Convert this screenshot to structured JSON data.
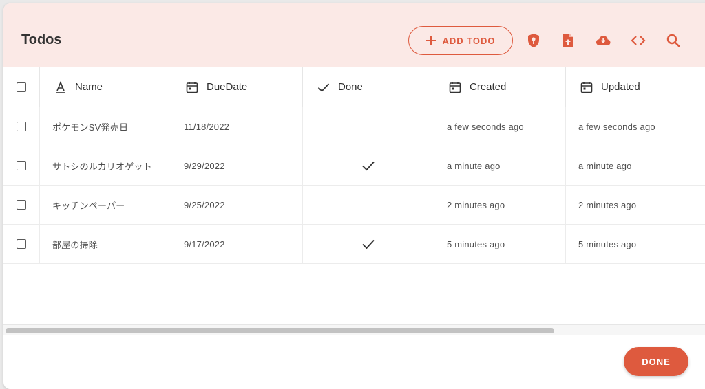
{
  "header": {
    "title": "Todos",
    "add_label": "ADD TODO"
  },
  "colors": {
    "accent": "#de5a3e",
    "header_bg": "#fbe9e6"
  },
  "icons": {
    "toolbar": [
      "shield-key-icon",
      "file-upload-icon",
      "cloud-download-icon",
      "code-icon",
      "search-icon"
    ]
  },
  "columns": [
    "Name",
    "DueDate",
    "Done",
    "Created",
    "Updated"
  ],
  "rows": [
    {
      "name": "ポケモンSV発売日",
      "due": "11/18/2022",
      "done": false,
      "created": "a few seconds ago",
      "updated": "a few seconds ago"
    },
    {
      "name": "サトシのルカリオゲット",
      "due": "9/29/2022",
      "done": true,
      "created": "a minute ago",
      "updated": "a minute ago"
    },
    {
      "name": "キッチンペーパー",
      "due": "9/25/2022",
      "done": false,
      "created": "2 minutes ago",
      "updated": "2 minutes ago"
    },
    {
      "name": "部屋の掃除",
      "due": "9/17/2022",
      "done": true,
      "created": "5 minutes ago",
      "updated": "5 minutes ago"
    }
  ],
  "footer": {
    "done_label": "DONE"
  }
}
